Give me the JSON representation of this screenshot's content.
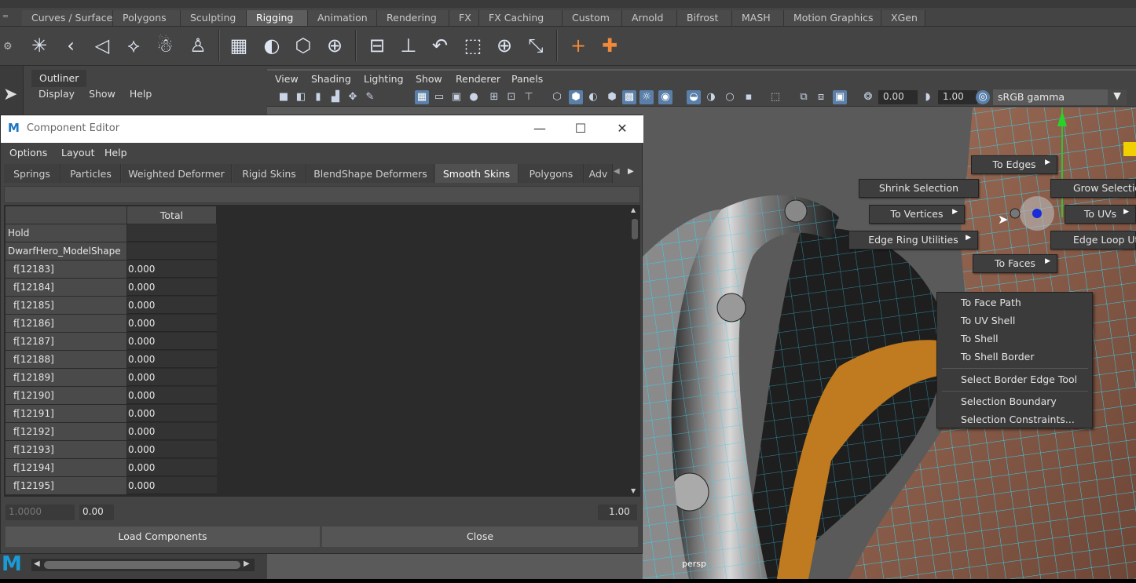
{
  "shelf": {
    "tabs": [
      "Curves / Surfaces",
      "Polygons",
      "Sculpting",
      "Rigging",
      "Animation",
      "Rendering",
      "FX",
      "FX Caching",
      "Custom",
      "Arnold",
      "Bifrost",
      "MASH",
      "Motion Graphics",
      "XGen"
    ],
    "active_tab": "Rigging"
  },
  "outliner": {
    "title": "Outliner",
    "menu": [
      "Display",
      "Show",
      "Help"
    ]
  },
  "viewport": {
    "menu": [
      "View",
      "Shading",
      "Lighting",
      "Show",
      "Renderer",
      "Panels"
    ],
    "exposure": "0.00",
    "gamma": "1.00",
    "color_space": "sRGB gamma",
    "camera_label": "persp"
  },
  "marking_menu": {
    "to_edges": "To Edges",
    "shrink_selection": "Shrink Selection",
    "grow_selection": "Grow Selectio",
    "to_vertices": "To Vertices",
    "to_uvs": "To UVs",
    "edge_ring_utilities": "Edge Ring Utilities",
    "edge_loop_utilities": "Edge Loop Ut",
    "to_faces": "To Faces",
    "popup_items": [
      "To Face Path",
      "To UV Shell",
      "To Shell",
      "To Shell Border",
      "Select Border Edge Tool",
      "Selection Boundary",
      "Selection Constraints..."
    ]
  },
  "component_editor": {
    "title": "Component Editor",
    "menu": [
      "Options",
      "Layout",
      "Help"
    ],
    "tabs": [
      "Springs",
      "Particles",
      "Weighted Deformer",
      "Rigid Skins",
      "BlendShape Deformers",
      "Smooth Skins",
      "Polygons",
      "Adv"
    ],
    "active_tab": "Smooth Skins",
    "column_header": "Total",
    "rows": [
      {
        "name": "Hold",
        "value": ""
      },
      {
        "name": "DwarfHero_ModelShape",
        "value": ""
      },
      {
        "name": "f[12183]",
        "value": "0.000"
      },
      {
        "name": "f[12184]",
        "value": "0.000"
      },
      {
        "name": "f[12185]",
        "value": "0.000"
      },
      {
        "name": "f[12186]",
        "value": "0.000"
      },
      {
        "name": "f[12187]",
        "value": "0.000"
      },
      {
        "name": "f[12188]",
        "value": "0.000"
      },
      {
        "name": "f[12189]",
        "value": "0.000"
      },
      {
        "name": "f[12190]",
        "value": "0.000"
      },
      {
        "name": "f[12191]",
        "value": "0.000"
      },
      {
        "name": "f[12192]",
        "value": "0.000"
      },
      {
        "name": "f[12193]",
        "value": "0.000"
      },
      {
        "name": "f[12194]",
        "value": "0.000"
      },
      {
        "name": "f[12195]",
        "value": "0.000"
      }
    ],
    "slider_max_field": "1.0000",
    "slider_min_value": "0.00",
    "slider_max_value": "1.00",
    "load_button": "Load Components",
    "close_button": "Close"
  },
  "colors": {
    "accent_blue": "#5a7fa8",
    "wire_cyan": "#35d0f0",
    "menu_bg": "#3e3e3e"
  }
}
